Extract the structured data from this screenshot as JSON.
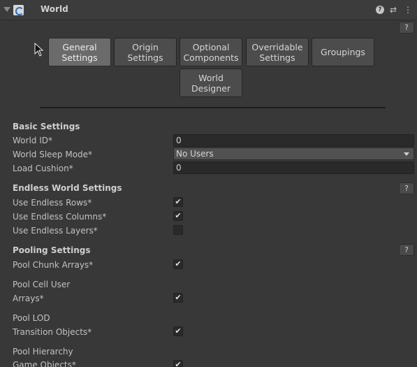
{
  "header": {
    "title": "World",
    "icons": [
      "foldout-arrow-icon",
      "script-icon",
      "help-icon",
      "presets-icon",
      "kebab-menu-icon"
    ]
  },
  "help_label": "?",
  "tabs": [
    {
      "label": "General\nSettings",
      "active": true
    },
    {
      "label": "Origin\nSettings",
      "active": false
    },
    {
      "label": "Optional\nComponents",
      "active": false
    },
    {
      "label": "Overridable\nSettings",
      "active": false
    },
    {
      "label": "Groupings",
      "active": false
    },
    {
      "label": "World\nDesigner",
      "active": false
    }
  ],
  "basic": {
    "title": "Basic Settings",
    "world_id_label": "World ID*",
    "world_id_value": "0",
    "sleep_mode_label": "World Sleep Mode*",
    "sleep_mode_value": "No Users",
    "load_cushion_label": "Load Cushion*",
    "load_cushion_value": "0"
  },
  "endless": {
    "title": "Endless World Settings",
    "rows_label": "Use Endless Rows*",
    "rows_checked": true,
    "columns_label": "Use Endless Columns*",
    "columns_checked": true,
    "layers_label": "Use Endless Layers*",
    "layers_checked": false
  },
  "pooling": {
    "title": "Pooling Settings",
    "chunk_arrays_label": "Pool Chunk Arrays*",
    "chunk_arrays_checked": true,
    "cell_user_label_1": "Pool Cell User",
    "cell_user_label_2": "Arrays*",
    "cell_user_checked": true,
    "lod_label_1": "Pool LOD",
    "lod_label_2": "Transition Objects*",
    "lod_checked": true,
    "hierarchy_label_1": "Pool Hierarchy",
    "hierarchy_label_2": "Game Objects*",
    "hierarchy_checked": true
  },
  "checkmark": "✔"
}
